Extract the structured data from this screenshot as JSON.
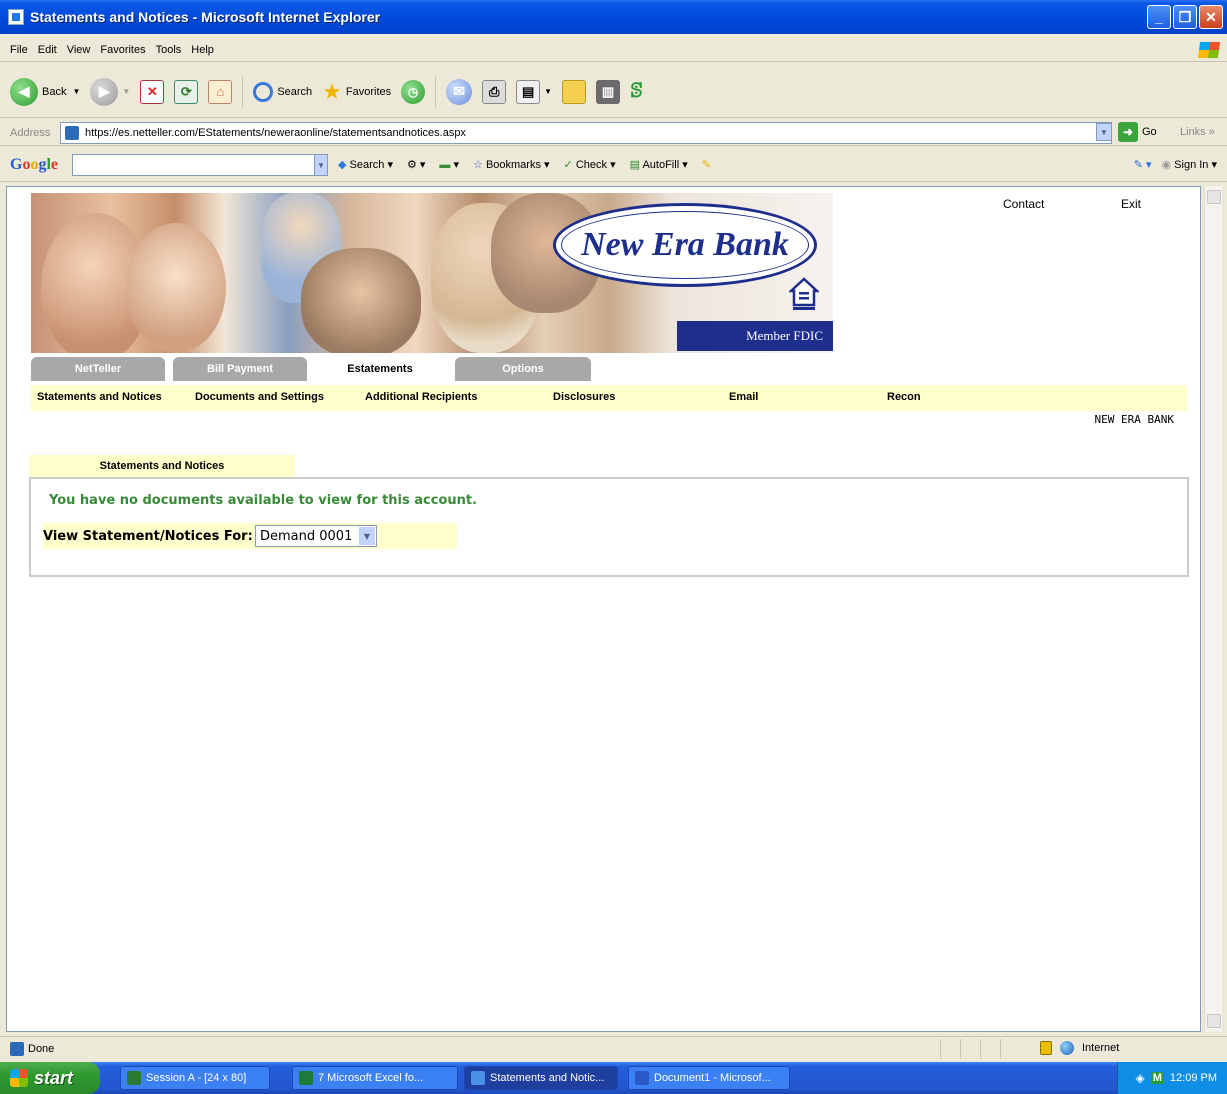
{
  "window": {
    "title": "Statements and Notices - Microsoft Internet Explorer"
  },
  "menu": [
    "File",
    "Edit",
    "View",
    "Favorites",
    "Tools",
    "Help"
  ],
  "toolbar": {
    "back_label": "Back",
    "search_label": "Search",
    "favorites_label": "Favorites"
  },
  "address": {
    "label": "Address",
    "url": "https://es.netteller.com/EStatements/neweraonline/statementsandnotices.aspx",
    "go_label": "Go",
    "links_label": "Links"
  },
  "google": {
    "logo": "Google",
    "search_label": "Search",
    "bookmarks_label": "Bookmarks",
    "check_label": "Check",
    "autofill_label": "AutoFill",
    "signin_label": "Sign In"
  },
  "page": {
    "top_links": {
      "contact": "Contact",
      "exit": "Exit"
    },
    "logo_text": "New Era Bank",
    "fdic_text": "Member FDIC",
    "tabs": [
      {
        "label": "NetTeller",
        "active": false
      },
      {
        "label": "Bill Payment",
        "active": false
      },
      {
        "label": "Estatements",
        "active": true
      },
      {
        "label": "Options",
        "active": false
      }
    ],
    "subnav": [
      "Statements and Notices",
      "Documents and Settings",
      "Additional Recipients",
      "Disclosures",
      "Email",
      "Recon"
    ],
    "bank_name": "NEW ERA BANK",
    "section_title": "Statements and Notices",
    "message": "You have no documents available to view for this account.",
    "view_label": "View Statement/Notices For:",
    "account_selected": "Demand 0001"
  },
  "status": {
    "text": "Done",
    "zone": "Internet"
  },
  "taskbar": {
    "start_label": "start",
    "tasks": [
      "Session A - [24 x 80]",
      "7 Microsoft Excel fo...",
      "Statements and Notic...",
      "Document1 - Microsof..."
    ],
    "clock": "12:09 PM"
  },
  "colors": {
    "titlebar": "#0048d8",
    "brand_navy": "#1e2e8c",
    "subnav_bg": "#ffffcc",
    "message_green": "#3a8a3a"
  }
}
